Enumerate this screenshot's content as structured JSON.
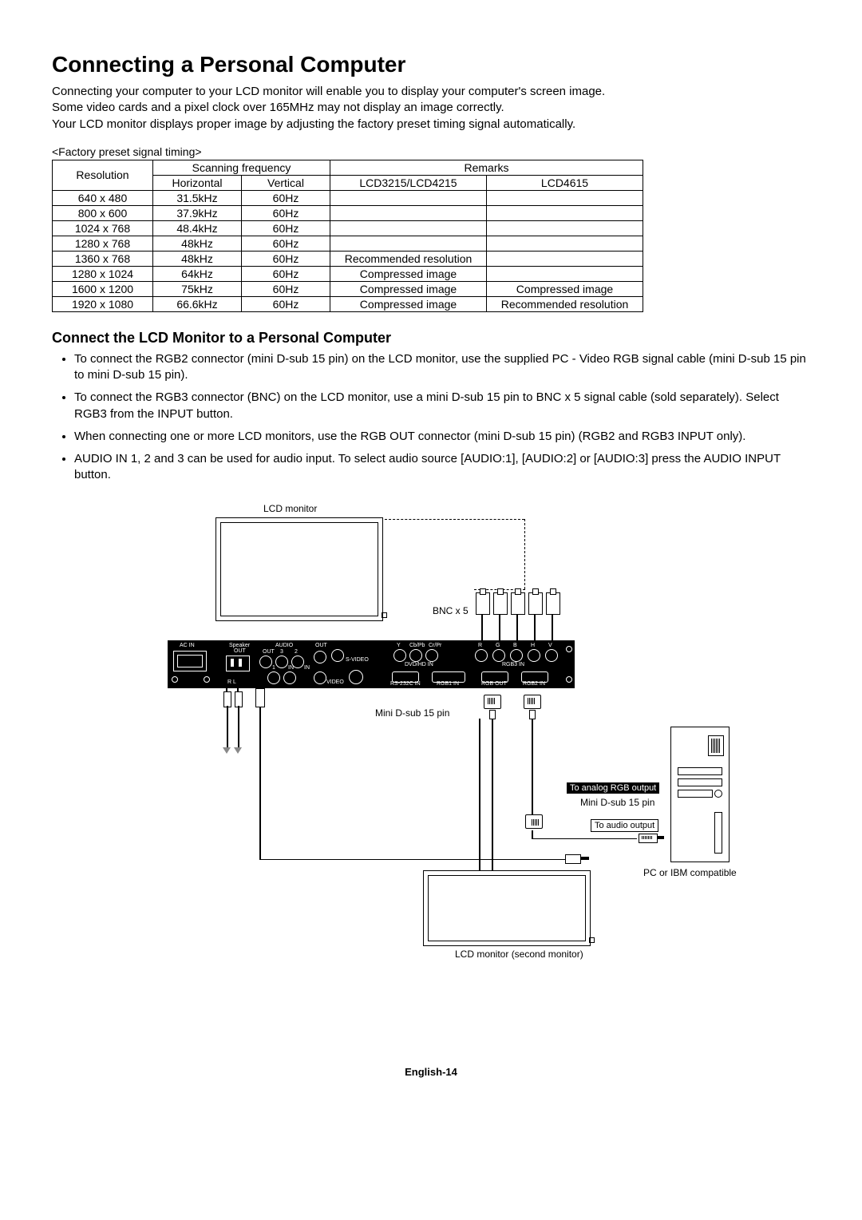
{
  "title": "Connecting a Personal Computer",
  "intro_lines": [
    "Connecting your computer to your LCD monitor will enable you to display your computer's screen image.",
    "Some video cards and a pixel clock over 165MHz may not display an image correctly.",
    "Your LCD monitor displays proper image by adjusting the factory preset timing signal automatically."
  ],
  "table_caption": "<Factory preset signal timing>",
  "table": {
    "resolution_header": "Resolution",
    "scanning_header": "Scanning frequency",
    "horizontal_header": "Horizontal",
    "vertical_header": "Vertical",
    "remarks_header": "Remarks",
    "remarks_sub1": "LCD3215/LCD4215",
    "remarks_sub2": "LCD4615",
    "rows": [
      {
        "res": "640 x 480",
        "hz": "31.5kHz",
        "vz": "60Hz",
        "r1": "",
        "r2": ""
      },
      {
        "res": "800 x 600",
        "hz": "37.9kHz",
        "vz": "60Hz",
        "r1": "",
        "r2": ""
      },
      {
        "res": "1024 x 768",
        "hz": "48.4kHz",
        "vz": "60Hz",
        "r1": "",
        "r2": ""
      },
      {
        "res": "1280 x 768",
        "hz": "48kHz",
        "vz": "60Hz",
        "r1": "",
        "r2": ""
      },
      {
        "res": "1360 x 768",
        "hz": "48kHz",
        "vz": "60Hz",
        "r1": "Recommended resolution",
        "r2": ""
      },
      {
        "res": "1280 x 1024",
        "hz": "64kHz",
        "vz": "60Hz",
        "r1": "Compressed image",
        "r2": ""
      },
      {
        "res": "1600 x 1200",
        "hz": "75kHz",
        "vz": "60Hz",
        "r1": "Compressed image",
        "r2": "Compressed image"
      },
      {
        "res": "1920 x 1080",
        "hz": "66.6kHz",
        "vz": "60Hz",
        "r1": "Compressed image",
        "r2": "Recommended resolution"
      }
    ]
  },
  "subhead": "Connect the LCD Monitor to a Personal Computer",
  "bullets": [
    "To connect the RGB2 connector (mini D-sub 15 pin) on the LCD monitor, use the supplied PC - Video RGB signal cable (mini D-sub 15 pin to mini D-sub 15 pin).",
    "To connect the RGB3 connector (BNC) on the LCD monitor, use a mini D-sub 15 pin to BNC x 5 signal cable (sold separately). Select RGB3 from the INPUT button.",
    "When connecting one or more LCD monitors, use the RGB OUT connector (mini D-sub 15 pin) (RGB2 and RGB3 INPUT only).",
    "AUDIO IN 1, 2 and 3 can be used for audio input. To select audio source [AUDIO:1], [AUDIO:2] or [AUDIO:3] press the AUDIO INPUT button."
  ],
  "diagram": {
    "lcd_monitor": "LCD monitor",
    "bnc_x5": "BNC x 5",
    "mini_dsub": "Mini D-sub 15 pin",
    "to_analog_rgb": "To analog RGB output",
    "mini_dsub_pc": "Mini D-sub 15 pin",
    "to_audio": "To audio output",
    "pc_label": "PC or IBM compatible",
    "second_monitor": "LCD monitor (second monitor)",
    "panel": {
      "ac_in": "AC IN",
      "speaker_out": "Speaker",
      "out": "OUT",
      "audio": "AUDIO",
      "video": "VIDEO",
      "svideo": "S-VIDEO",
      "in": "IN",
      "one": "1",
      "two": "2",
      "three": "3",
      "rl": "R   L",
      "y": "Y",
      "cbpb": "Cb/Pb",
      "crpr": "Cr/Pr",
      "dvdhd": "DVD/HD IN",
      "r": "R",
      "g": "G",
      "b": "B",
      "h": "H",
      "v": "V",
      "rgb3": "RGB3 IN",
      "rs232c": "RS-232C IN",
      "rgb1": "RGB1  IN",
      "rgbout": "RGB OUT",
      "rgb2": "RGB2  IN"
    }
  },
  "footer": "English-14"
}
